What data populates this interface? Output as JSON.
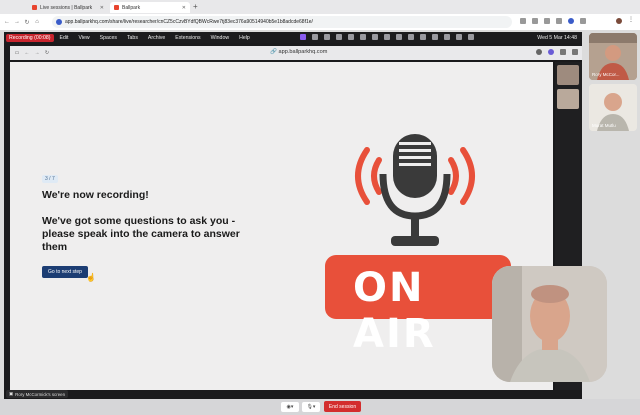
{
  "browser": {
    "tabs": [
      {
        "label": "Live sessions | Ballpark"
      },
      {
        "label": "Ballpark"
      }
    ],
    "new_tab": "+",
    "url": "app.ballparkhq.com/share/live/researcher/cnCZ5cCzvBYdfQBWcRwe7tj83ec376a90514940b5e1b8adcde68f1e/"
  },
  "menubar": {
    "recording": "Recording (00:08)",
    "items": [
      "Edit",
      "View",
      "Spaces",
      "Tabs",
      "Archive",
      "Extensions",
      "Window",
      "Help"
    ],
    "datetime": "Wed 5 Mar  14:48"
  },
  "inner": {
    "url": "app.ballparkhq.com"
  },
  "content": {
    "step": "3 / 7",
    "title": "We're now recording!",
    "body": "We've got some questions to ask you - please speak into the camera to answer them",
    "button": "Go to next step",
    "poster_text": "ON AIR"
  },
  "participants": [
    {
      "name": "Rory McCor..."
    },
    {
      "name": "Murat Mutlu"
    }
  ],
  "screen_label": "Rory McCormick's screen",
  "bottom": {
    "end": "End session"
  },
  "colors": {
    "accent_red": "#e8503a",
    "button_blue": "#1c3d73"
  }
}
